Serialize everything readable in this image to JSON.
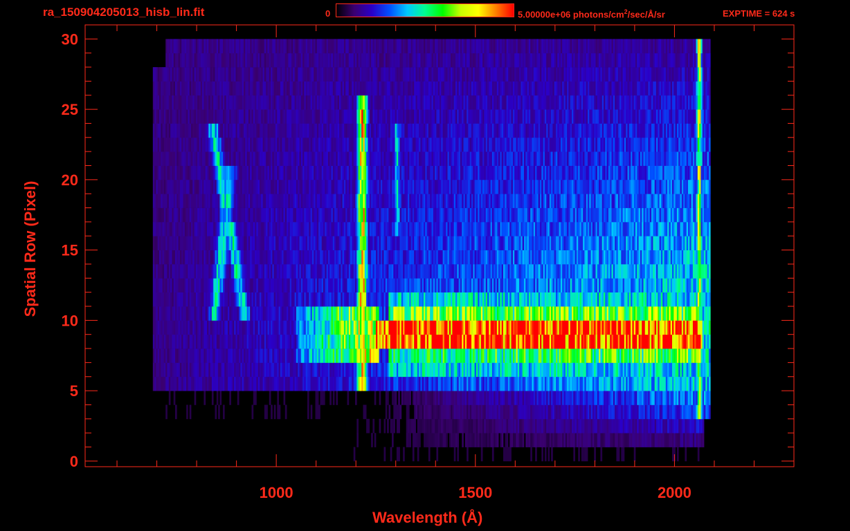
{
  "header": {
    "title": "ra_150904205013_hisb_lin.fit",
    "colorbar_min": "0",
    "colorbar_max_value": "5.00000e+06 photons/cm",
    "colorbar_max_sup": "2",
    "colorbar_max_rest": "/sec/Å/sr",
    "exptime": "EXPTIME = 624 s"
  },
  "colors": {
    "axis": "#ff2a1a",
    "background": "#000000",
    "colormap": [
      "#000000",
      "#3a0070",
      "#2a00c8",
      "#0050ff",
      "#00c8ff",
      "#00ff90",
      "#00ff00",
      "#c8ff00",
      "#ffff00",
      "#ff8000",
      "#ff0000"
    ]
  },
  "chart_data": {
    "type": "heatmap",
    "title": "ra_150904205013_hisb_lin.fit",
    "xlabel": "Wavelength (Å)",
    "ylabel": "Spatial Row (Pixel)",
    "xlim": [
      520,
      2300
    ],
    "ylim": [
      -0.4,
      31
    ],
    "xticks": [
      1000,
      1500,
      2000
    ],
    "yticks": [
      0,
      5,
      10,
      15,
      20,
      25,
      30
    ],
    "grid": false,
    "colorbar": {
      "min": 0,
      "max": 5000000,
      "units": "photons/cm^2/sec/Å/sr"
    },
    "rows": 30,
    "data_wavelength_range": [
      690,
      2090
    ],
    "features": [
      {
        "name": "Lyman-alpha emission",
        "wavelength": 1216,
        "rows": [
          5,
          25
        ]
      },
      {
        "name": "line near 1304",
        "wavelength": 1304,
        "rows": [
          16,
          23
        ]
      },
      {
        "name": "bright continuum band",
        "wavelength_range": [
          1260,
          2070
        ],
        "rows": [
          8,
          10
        ]
      },
      {
        "name": "lambda-shaped feature",
        "wavelength_range": [
          800,
          960
        ],
        "rows": [
          10,
          23
        ]
      }
    ]
  }
}
